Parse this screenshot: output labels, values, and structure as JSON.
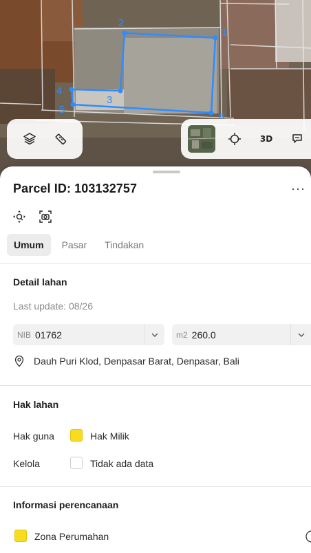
{
  "map": {
    "parcel_points": [
      "1",
      "2",
      "3",
      "4",
      "5",
      "6"
    ],
    "outline_color": "#2f8cff",
    "buttons": {
      "layers_icon": "layers-icon",
      "measure_icon": "ruler-icon",
      "thumbnail_icon": "satellite-thumbnail",
      "locate_icon": "crosshair-icon",
      "view_3d_label": "3D",
      "feedback_icon": "chat-icon"
    }
  },
  "sheet": {
    "title": "Parcel ID: 103132757",
    "more_label": "···",
    "close_label": "×",
    "tools": [
      "zoom-to-parcel-icon",
      "screenshot-icon"
    ],
    "tabs": [
      {
        "label": "Umum",
        "active": true
      },
      {
        "label": "Pasar",
        "active": false
      },
      {
        "label": "Tindakan",
        "active": false
      }
    ],
    "land_detail": {
      "title": "Detail lahan",
      "last_update": "Last update: 08/26",
      "nib_prefix": "NIB",
      "nib_value": "01762",
      "area_prefix": "m2",
      "area_value": "260.0",
      "address": "Dauh Puri Klod, Denpasar Barat, Denpasar, Bali"
    },
    "land_rights": {
      "title": "Hak lahan",
      "rows": [
        {
          "label": "Hak guna",
          "value": "Hak Milik",
          "swatch": "#f7dc22"
        },
        {
          "label": "Kelola",
          "value": "Tidak ada data",
          "swatch": "#ffffff"
        }
      ]
    },
    "planning": {
      "title": "Informasi perencanaan",
      "zone": "Zona Perumahan",
      "zone_swatch": "#f7dc22"
    }
  }
}
